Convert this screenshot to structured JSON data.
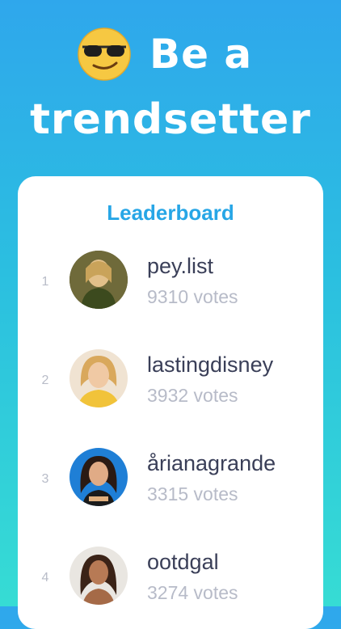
{
  "hero": {
    "title_line1": "Be a",
    "title_line2": "trendsetter",
    "emoji_icon": "sunglasses-face-icon"
  },
  "leaderboard": {
    "title": "Leaderboard",
    "entries": [
      {
        "rank": "1",
        "username": "pey.list",
        "votes": "9310 votes"
      },
      {
        "rank": "2",
        "username": "lastingdisney",
        "votes": "3932 votes"
      },
      {
        "rank": "3",
        "username": "årianagrande",
        "votes": "3315 votes"
      },
      {
        "rank": "4",
        "username": "ootdgal",
        "votes": "3274 votes"
      }
    ]
  },
  "colors": {
    "background_top": "#2fa7ec",
    "background_bottom": "#36dcd4",
    "accent": "#27a6e6",
    "name_text": "#3a3f58",
    "muted_text": "#b7bbc8"
  }
}
